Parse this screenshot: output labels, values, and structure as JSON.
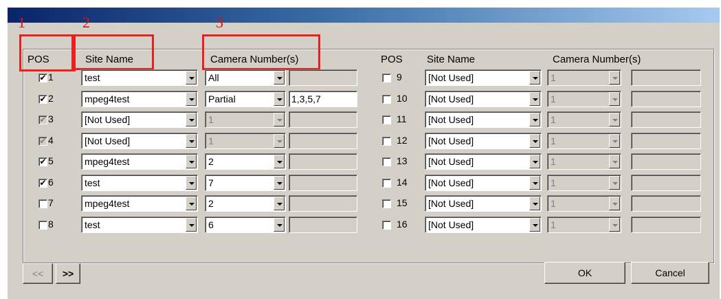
{
  "headers": {
    "left": {
      "pos": "POS",
      "site": "Site Name",
      "camera": "Camera Number(s)"
    },
    "right": {
      "pos": "POS",
      "site": "Site Name",
      "camera": "Camera Number(s)"
    }
  },
  "annotations": [
    "1",
    "2",
    "3"
  ],
  "rows_left": [
    {
      "num": "1",
      "checked": true,
      "check_enabled": true,
      "site": "test",
      "site_enabled": true,
      "camera": "All",
      "camera_enabled": true,
      "numbers": "",
      "numbers_enabled": false
    },
    {
      "num": "2",
      "checked": true,
      "check_enabled": true,
      "site": "mpeg4test",
      "site_enabled": true,
      "camera": "Partial",
      "camera_enabled": true,
      "numbers": "1,3,5,7",
      "numbers_enabled": true
    },
    {
      "num": "3",
      "checked": true,
      "check_enabled": false,
      "site": "[Not Used]",
      "site_enabled": true,
      "camera": "1",
      "camera_enabled": false,
      "numbers": "",
      "numbers_enabled": false
    },
    {
      "num": "4",
      "checked": true,
      "check_enabled": false,
      "site": "[Not Used]",
      "site_enabled": true,
      "camera": "1",
      "camera_enabled": false,
      "numbers": "",
      "numbers_enabled": false
    },
    {
      "num": "5",
      "checked": true,
      "check_enabled": true,
      "site": "mpeg4test",
      "site_enabled": true,
      "camera": "2",
      "camera_enabled": true,
      "numbers": "",
      "numbers_enabled": false
    },
    {
      "num": "6",
      "checked": true,
      "check_enabled": true,
      "site": "test",
      "site_enabled": true,
      "camera": "7",
      "camera_enabled": true,
      "numbers": "",
      "numbers_enabled": false
    },
    {
      "num": "7",
      "checked": false,
      "check_enabled": true,
      "site": "mpeg4test",
      "site_enabled": true,
      "camera": "2",
      "camera_enabled": true,
      "numbers": "",
      "numbers_enabled": false
    },
    {
      "num": "8",
      "checked": false,
      "check_enabled": true,
      "site": "test",
      "site_enabled": true,
      "camera": "6",
      "camera_enabled": true,
      "numbers": "",
      "numbers_enabled": false
    }
  ],
  "rows_right": [
    {
      "num": "9",
      "checked": false,
      "check_enabled": true,
      "site": "[Not Used]",
      "site_enabled": true,
      "camera": "1",
      "camera_enabled": false,
      "numbers": "",
      "numbers_enabled": false
    },
    {
      "num": "10",
      "checked": false,
      "check_enabled": true,
      "site": "[Not Used]",
      "site_enabled": true,
      "camera": "1",
      "camera_enabled": false,
      "numbers": "",
      "numbers_enabled": false
    },
    {
      "num": "11",
      "checked": false,
      "check_enabled": true,
      "site": "[Not Used]",
      "site_enabled": true,
      "camera": "1",
      "camera_enabled": false,
      "numbers": "",
      "numbers_enabled": false
    },
    {
      "num": "12",
      "checked": false,
      "check_enabled": true,
      "site": "[Not Used]",
      "site_enabled": true,
      "camera": "1",
      "camera_enabled": false,
      "numbers": "",
      "numbers_enabled": false
    },
    {
      "num": "13",
      "checked": false,
      "check_enabled": true,
      "site": "[Not Used]",
      "site_enabled": true,
      "camera": "1",
      "camera_enabled": false,
      "numbers": "",
      "numbers_enabled": false
    },
    {
      "num": "14",
      "checked": false,
      "check_enabled": true,
      "site": "[Not Used]",
      "site_enabled": true,
      "camera": "1",
      "camera_enabled": false,
      "numbers": "",
      "numbers_enabled": false
    },
    {
      "num": "15",
      "checked": false,
      "check_enabled": true,
      "site": "[Not Used]",
      "site_enabled": true,
      "camera": "1",
      "camera_enabled": false,
      "numbers": "",
      "numbers_enabled": false
    },
    {
      "num": "16",
      "checked": false,
      "check_enabled": true,
      "site": "[Not Used]",
      "site_enabled": true,
      "camera": "1",
      "camera_enabled": false,
      "numbers": "",
      "numbers_enabled": false
    }
  ],
  "buttons": {
    "prev": "<<",
    "next": ">>",
    "ok": "OK",
    "cancel": "Cancel"
  },
  "colors": {
    "annotation": "#e82020",
    "dialog_bg": "#d4d0c8",
    "title_start": "#0a246a",
    "title_end": "#a6caf0"
  }
}
